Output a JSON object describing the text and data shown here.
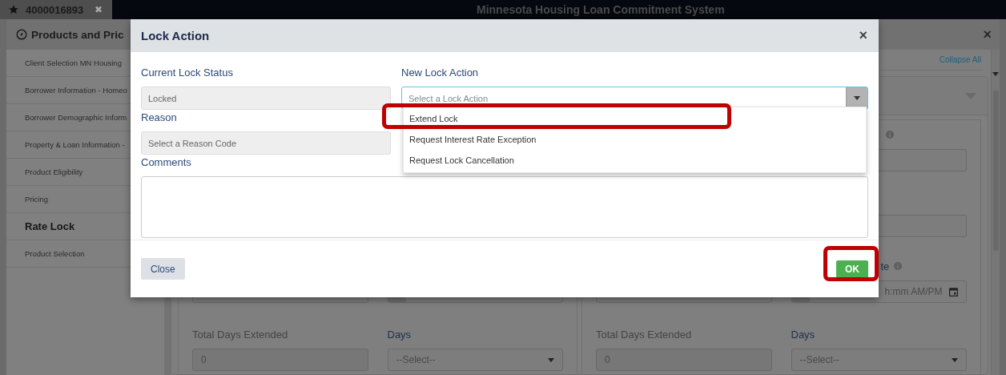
{
  "top_bar": {
    "tab": {
      "label": "4000016893",
      "close": "✖"
    },
    "title": "Minnesota Housing Loan Commitment System"
  },
  "panel": {
    "title": "Products and Pric",
    "close": "×",
    "collapse_link": "Collapse All"
  },
  "sidebar": {
    "items": [
      {
        "label": "Client Selection MN Housing",
        "selected": false
      },
      {
        "label": "Borrower Information - Homeo",
        "selected": false
      },
      {
        "label": "Borrower Demographic Inform",
        "selected": false
      },
      {
        "label": "Property & Loan Information -",
        "selected": false
      },
      {
        "label": "Product Eligibility",
        "selected": false
      },
      {
        "label": "Pricing",
        "selected": false
      },
      {
        "label": "Rate Lock",
        "selected": true
      },
      {
        "label": "Product Selection",
        "selected": false
      }
    ]
  },
  "detail_cards": [
    {
      "total_days": {
        "label": "Total Days Extended",
        "value": "0"
      },
      "days": {
        "label": "Days",
        "placeholder": "--Select--"
      }
    },
    {
      "total_days": {
        "label": "Total Days Extended",
        "value": "0"
      },
      "days": {
        "label": "Days",
        "placeholder": "--Select--"
      },
      "side_column": {
        "partial_label": "te",
        "date_value": "h:mm AM/PM"
      }
    }
  ],
  "modal": {
    "title": "Lock Action",
    "close": "×",
    "current_lock_status": {
      "label": "Current Lock Status",
      "value": "Locked"
    },
    "new_lock_action": {
      "label": "New Lock Action",
      "placeholder": "Select a Lock Action",
      "expanded": true,
      "options": [
        {
          "label": "Extend Lock",
          "highlighted": true
        },
        {
          "label": "Request Interest Rate Exception",
          "highlighted": false
        },
        {
          "label": "Request Lock Cancellation",
          "highlighted": false
        }
      ]
    },
    "reason": {
      "label": "Reason",
      "placeholder": "Select a Reason Code"
    },
    "comments": {
      "label": "Comments"
    },
    "buttons": [
      {
        "label": "Close",
        "kind": "secondary",
        "highlighted": false
      },
      {
        "label": "OK",
        "kind": "primary",
        "highlighted": true
      }
    ]
  }
}
